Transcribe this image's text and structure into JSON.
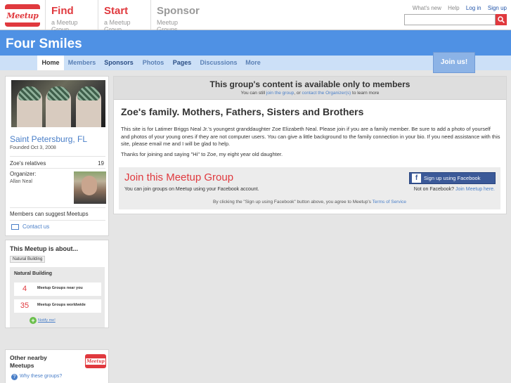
{
  "header": {
    "logo_text": "Meetup",
    "find": {
      "title": "Find",
      "sub": "a Meetup Group"
    },
    "start": {
      "title": "Start",
      "sub": "a Meetup Group"
    },
    "sponsor": {
      "title": "Sponsor",
      "sub": "Meetup Groups"
    },
    "links": {
      "whats_new": "What's new",
      "help": "Help",
      "login": "Log in",
      "signup": "Sign up"
    },
    "search": {
      "value": "",
      "placeholder": ""
    }
  },
  "group": {
    "name": "Four Smiles",
    "join_button": "Join us!"
  },
  "tabs": [
    {
      "label": "Home"
    },
    {
      "label": "Members"
    },
    {
      "label": "Sponsors"
    },
    {
      "label": "Photos"
    },
    {
      "label": "Pages"
    },
    {
      "label": "Discussions"
    },
    {
      "label": "More"
    }
  ],
  "sidebar": {
    "city": "Saint Petersburg, FL",
    "founded": "Founded Oct 3, 2008",
    "members_label": "Zoe's relatives",
    "members_count": "19",
    "organizer_label": "Organizer:",
    "organizer_name": "Allan Neal",
    "suggest": "Members can suggest Meetups",
    "contact": "Contact us",
    "about_title": "This Meetup is about...",
    "topic_tag": "Natural Building",
    "topic_box_title": "Natural Building",
    "near_count": "4",
    "near_label": "Meetup Groups near you",
    "world_count": "35",
    "world_label": "Meetup Groups worldwide",
    "notify": "Notify me!",
    "other_title": "Other nearby Meetups",
    "why": "Why these groups?"
  },
  "main": {
    "notice_title": "This group's content is available only to members",
    "notice_pre": "You can still ",
    "notice_join": "join the group",
    "notice_or": ", or ",
    "notice_contact": "contact the Organizer(s)",
    "notice_post": " to learn more",
    "title": "Zoe's family. Mothers, Fathers, Sisters and Brothers",
    "description": "This site is for Latimer Briggs Neal Jr.'s youngest granddaughter Zoe Elizabeth Neal. Please join if you are a family member. Be sure to add a photo of yourself and photos of your young ones if they are not computer users. You can give a little background to the family connection in your bio. If you need assistance with this site, please email me and I will be glad to help.",
    "thanks": "Thanks for joining and saying \"Hi\" to Zoe, my eight year old daughter.",
    "join_title": "Join this Meetup Group",
    "join_sub": "You can join groups on Meetup using your Facebook account.",
    "fb_button": "Sign up using Facebook",
    "not_on_fb": "Not on Facebook? ",
    "join_meetup_here": "Join Meetup here.",
    "terms_pre": "By clicking the \"Sign up using Facebook\" button above, you agree to Meetup's ",
    "terms_link": "Terms of Service"
  },
  "colors": {
    "brand_red": "#e0393e",
    "banner_blue": "#4f91e4",
    "facebook": "#3b5998"
  }
}
